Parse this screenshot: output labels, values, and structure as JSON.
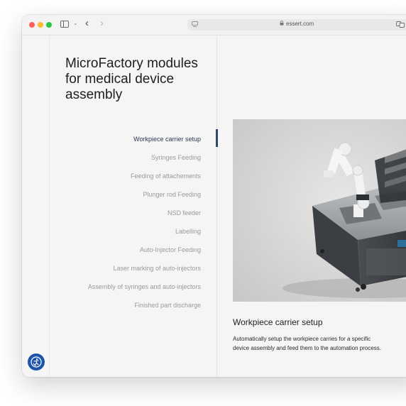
{
  "browser": {
    "url": "essert.com"
  },
  "page": {
    "title": "MicroFactory modules for medical device assembly"
  },
  "modules": [
    {
      "label": "Workpiece carrier setup",
      "active": true
    },
    {
      "label": "Syringes Feeding",
      "active": false
    },
    {
      "label": "Feeding of attachements",
      "active": false
    },
    {
      "label": "Plunger rod Feeding",
      "active": false
    },
    {
      "label": "NSD feeder",
      "active": false
    },
    {
      "label": "Labelling",
      "active": false
    },
    {
      "label": "Auto-Injector Feeding",
      "active": false
    },
    {
      "label": "Laser marking of auto-injectors",
      "active": false
    },
    {
      "label": "Assembly of syringes and auto-injectors",
      "active": false
    },
    {
      "label": "Finished part discharge",
      "active": false
    }
  ],
  "detail": {
    "title": "Workpiece carrier setup",
    "description": "Automatically setup the workpiece carries for a specific device assembly and feed them to the automation process."
  },
  "colors": {
    "accent": "#2e4a66",
    "accessibility_button": "#1c55a8",
    "photo_background": "#d8d7d5"
  },
  "icons": {
    "accessibility": "accessibility-icon",
    "lock": "lock-icon",
    "sidebar": "sidebar-toggle-icon"
  }
}
